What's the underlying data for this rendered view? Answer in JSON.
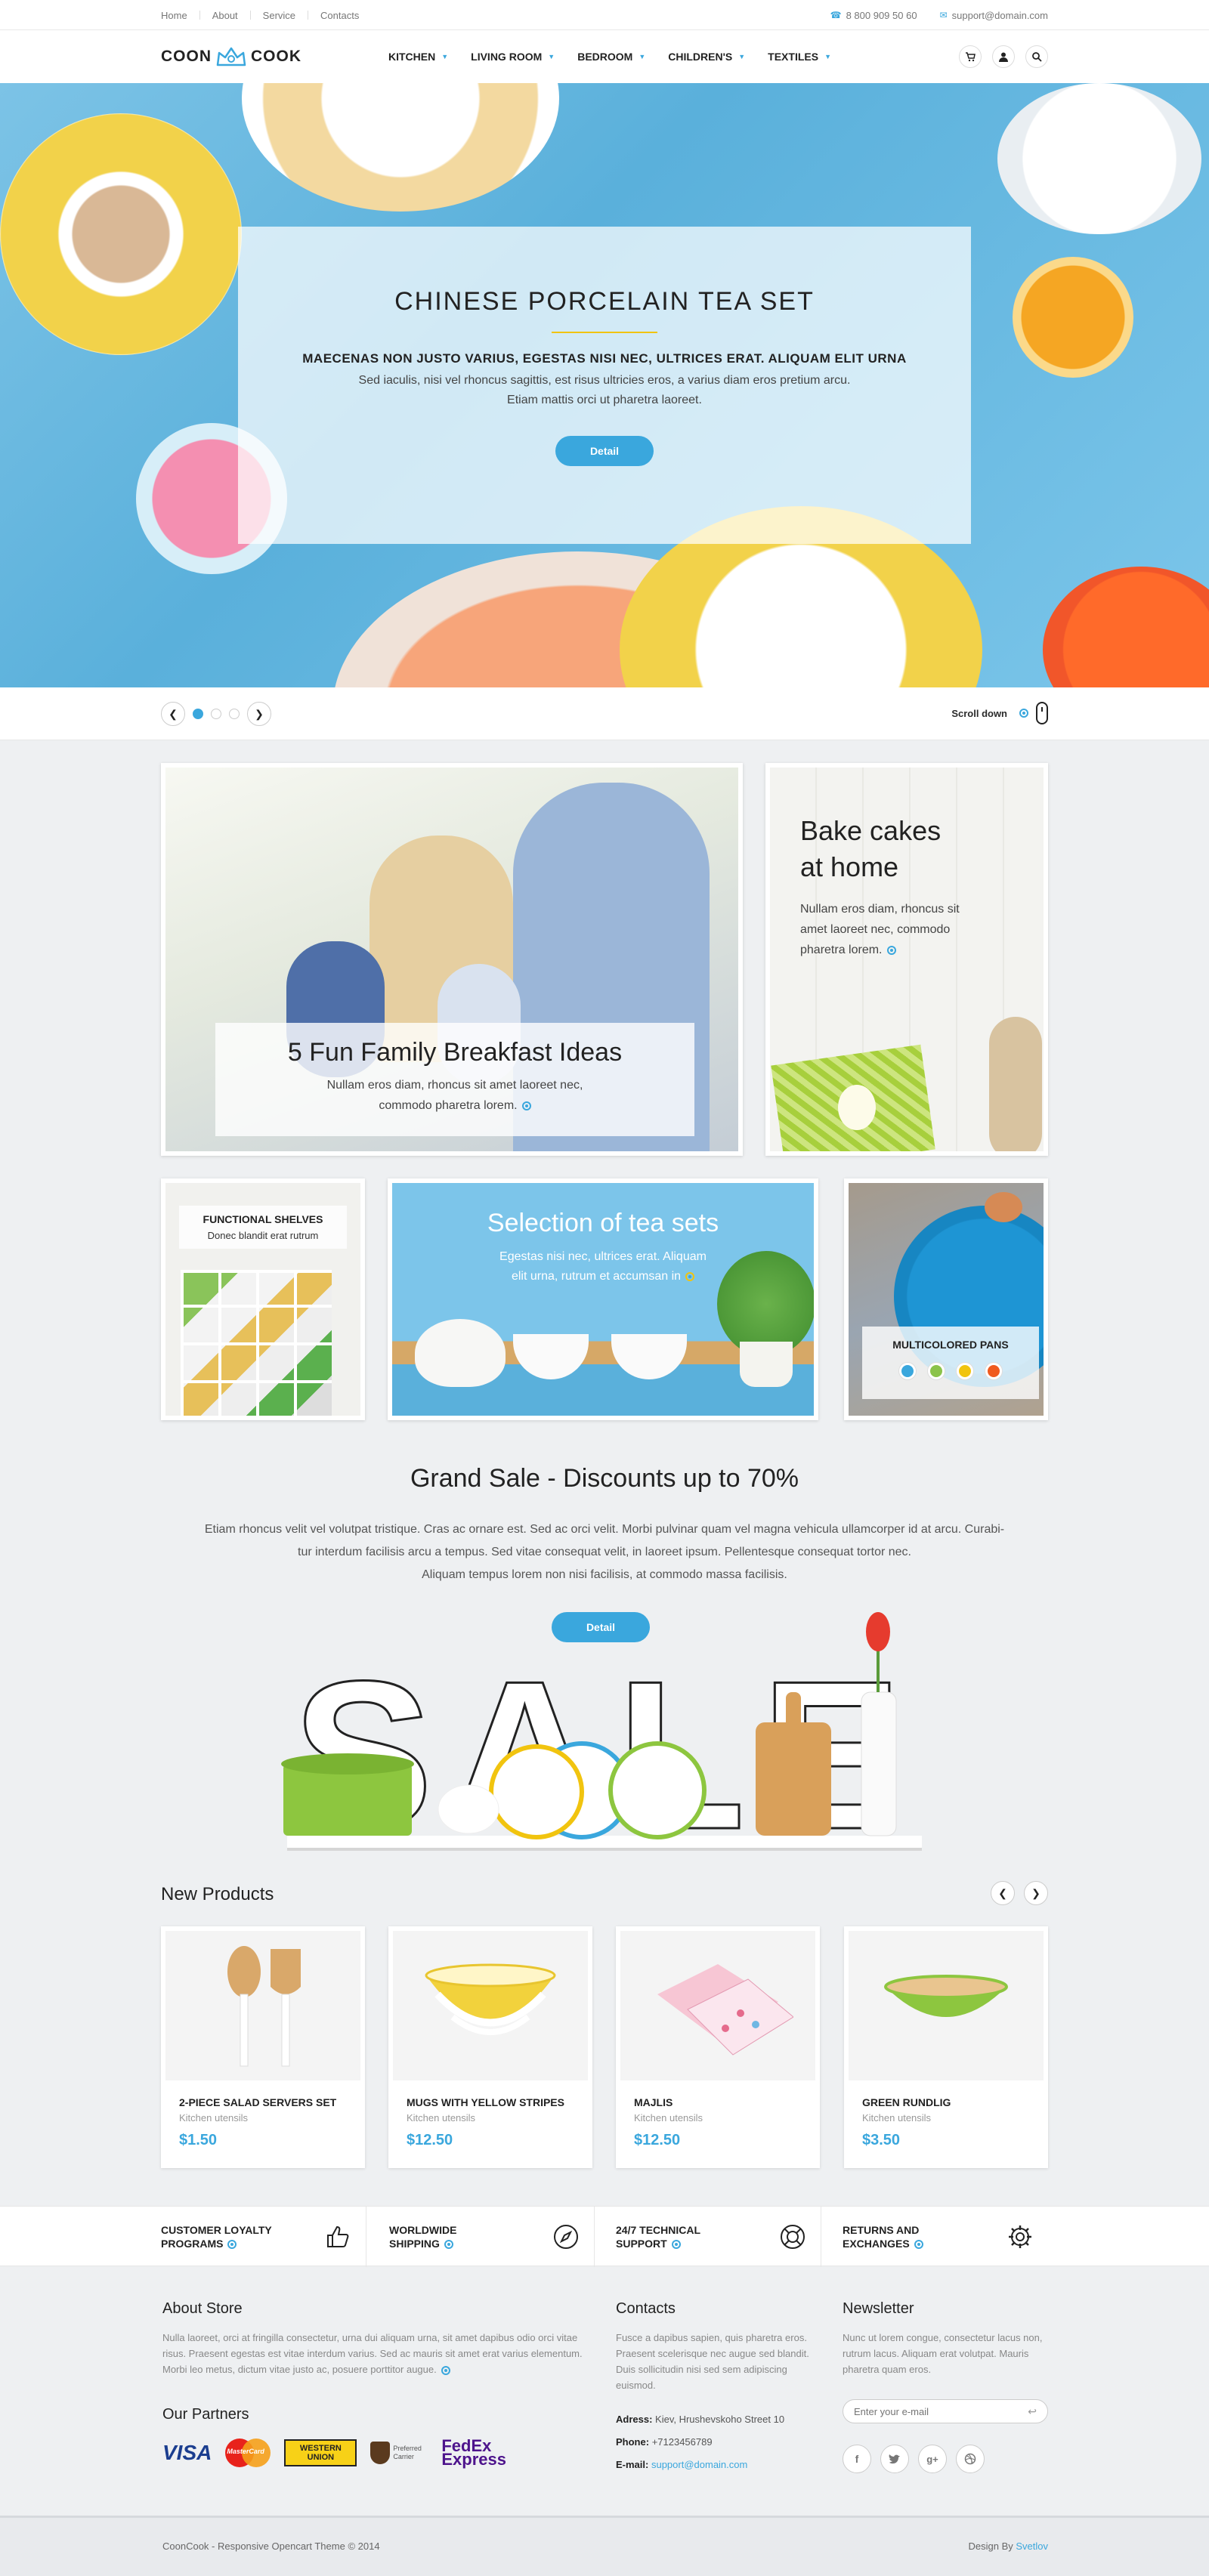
{
  "topbar": {
    "links": [
      "Home",
      "About",
      "Service",
      "Contacts"
    ],
    "phone": "8 800 909 50 60",
    "email": "support@domain.com"
  },
  "header": {
    "logo_left": "COON",
    "logo_right": "COOK",
    "nav": [
      "KITCHEN",
      "LIVING ROOM",
      "BEDROOM",
      "CHILDREN'S",
      "TEXTILES"
    ]
  },
  "hero": {
    "title": "CHINESE PORCELAIN TEA SET",
    "subtitle": "MAECENAS NON JUSTO VARIUS, EGESTAS NISI NEC, ULTRICES ERAT. ALIQUAM ELIT URNA",
    "text1": "Sed iaculis, nisi vel rhoncus sagittis, est risus ultricies eros, a varius diam eros pretium arcu.",
    "text2": "Etiam mattis orci ut pharetra laoreet.",
    "button": "Detail",
    "active_slide": 1,
    "slide_count": 3,
    "scroll_label": "Scroll down"
  },
  "promo": {
    "family": {
      "title": "5 Fun Family Breakfast Ideas",
      "text1": "Nullam eros diam, rhoncus sit amet laoreet nec,",
      "text2": "commodo pharetra lorem."
    },
    "bake": {
      "title1": "Bake cakes",
      "title2": "at home",
      "text1": "Nullam eros diam, rhoncus sit",
      "text2": "amet laoreet nec, commodo",
      "text3": "pharetra lorem."
    },
    "shelves": {
      "title": "FUNCTIONAL SHELVES",
      "text": "Donec blandit erat rutrum"
    },
    "tea": {
      "title": "Selection of tea sets",
      "text1": "Egestas nisi nec, ultrices erat. Aliquam",
      "text2": "elit urna, rutrum et accumsan in"
    },
    "pans": {
      "title": "MULTICOLORED PANS",
      "colors": [
        "#3aa7dd",
        "#8bc34a",
        "#f1c40f",
        "#f05a1e"
      ]
    }
  },
  "sale": {
    "title": "Grand Sale - Discounts up to 70%",
    "line1": "Etiam rhoncus velit vel volutpat tristique. Cras ac ornare est. Sed ac orci velit. Morbi pulvinar quam vel magna vehicula ullamcorper id at arcu. Curabi-",
    "line2": "tur interdum facilisis arcu a tempus. Sed vitae consequat velit, in laoreet ipsum. Pellentesque consequat tortor nec.",
    "line3": "Aliquam tempus lorem non nisi facilisis, at commodo massa facilisis.",
    "button": "Detail",
    "word": "SALE"
  },
  "products": {
    "heading": "New Products",
    "items": [
      {
        "name": "2-PIECE SALAD SERVERS SET",
        "category": "Kitchen utensils",
        "price": "$1.50"
      },
      {
        "name": "MUGS WITH YELLOW STRIPES",
        "category": "Kitchen utensils",
        "price": "$12.50"
      },
      {
        "name": "MAJLIS",
        "category": "Kitchen utensils",
        "price": "$12.50"
      },
      {
        "name": "GREEN RUNDLIG",
        "category": "Kitchen utensils",
        "price": "$3.50"
      }
    ]
  },
  "features": [
    {
      "line1": "CUSTOMER LOYALTY",
      "line2": "PROGRAMS",
      "icon": "thumbs-up-icon"
    },
    {
      "line1": "WORLDWIDE",
      "line2": "SHIPPING",
      "icon": "compass-icon"
    },
    {
      "line1": "24/7 TECHNICAL",
      "line2": "SUPPORT",
      "icon": "lifebuoy-icon"
    },
    {
      "line1": "RETURNS AND",
      "line2": "EXCHANGES",
      "icon": "gear-icon"
    }
  ],
  "footer": {
    "about_title": "About Store",
    "about_text": "Nulla laoreet, orci at fringilla consectetur, urna dui aliquam urna, sit amet dapibus odio orci vitae risus. Praesent egestas est vitae interdum varius. Sed ac mauris sit amet erat varius elementum. Morbi leo metus, dictum vitae justo ac, posuere porttitor augue.",
    "partners_title": "Our Partners",
    "partners": [
      "VISA",
      "MasterCard",
      "WESTERN UNION",
      "Preferred Carrier",
      "FedEx Express"
    ],
    "contacts_title": "Contacts",
    "contacts_text": "Fusce a dapibus sapien, quis pharetra eros. Praesent scelerisque nec augue sed blandit. Duis sollicitudin nisi sed sem adipiscing euismod.",
    "address_label": "Adress:",
    "address": "Kiev, Hrushevskoho Street 10",
    "phone_label": "Phone:",
    "phone": "+7123456789",
    "email_label": "E-mail:",
    "email": "support@domain.com",
    "newsletter_title": "Newsletter",
    "newsletter_text": "Nunc ut lorem congue, consectetur lacus non, rutrum lacus. Aliquam erat volutpat. Mauris pharetra quam eros.",
    "newsletter_placeholder": "Enter your e-mail",
    "copyright": "CoonCook - Responsive Opencart Theme © 2014",
    "design_by": "Design By",
    "designer": "Svetlov"
  },
  "colors": {
    "accent": "#3aa7dd",
    "yellow": "#f1c40f"
  }
}
